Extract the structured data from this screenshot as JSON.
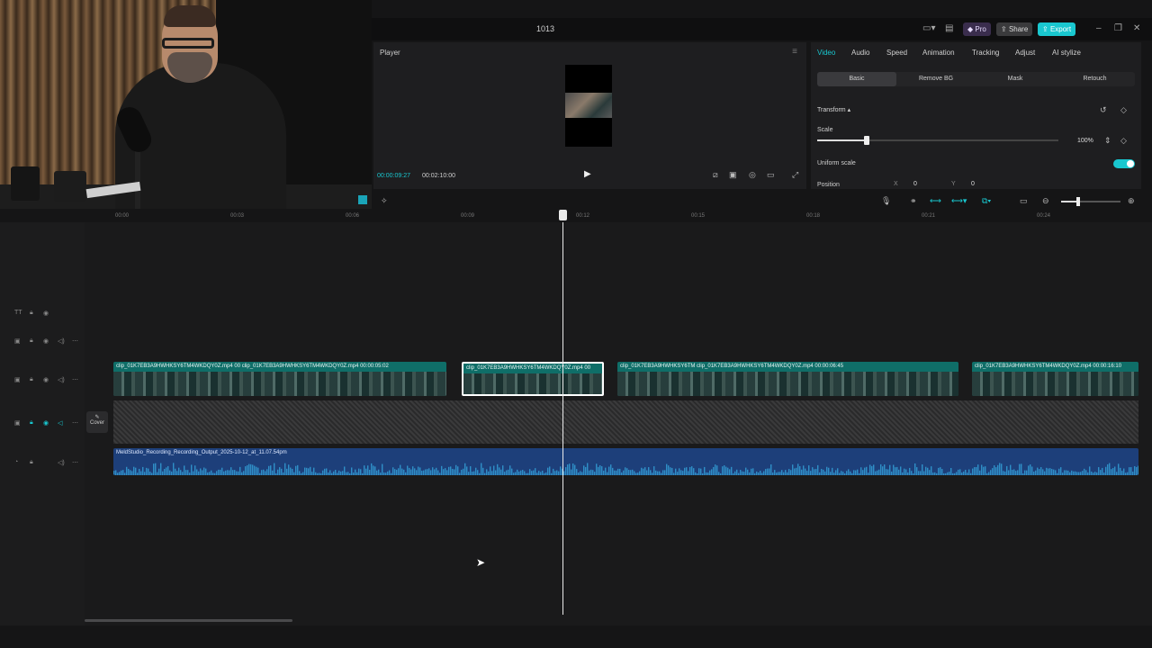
{
  "window": {
    "title": "1013"
  },
  "topbar": {
    "pro_label": "Pro",
    "share_label": "Share",
    "export_label": "Export"
  },
  "player": {
    "title": "Player",
    "current_time": "00:00:09:27",
    "total_time": "00:02:10:00"
  },
  "inspector": {
    "tabs": [
      "Video",
      "Audio",
      "Speed",
      "Animation",
      "Tracking",
      "Adjust",
      "AI stylize"
    ],
    "active_tab": "Video",
    "subtabs": [
      "Basic",
      "Remove BG",
      "Mask",
      "Retouch"
    ],
    "active_subtab": "Basic",
    "transform_label": "Transform",
    "scale_label": "Scale",
    "scale_value": "100%",
    "uniform_scale_label": "Uniform scale",
    "uniform_scale_on": true,
    "position_label": "Position",
    "x_label": "X",
    "x_value": "0",
    "y_label": "Y",
    "y_value": "0"
  },
  "ruler": {
    "ticks": [
      "00:00",
      "00:03",
      "00:06",
      "00:09",
      "00:12",
      "00:15",
      "00:18",
      "00:21",
      "00:24"
    ]
  },
  "timeline": {
    "cover_label": "Cover",
    "clips": [
      {
        "label": "clip_01K7EB3A9HWHKSY6TM4WKDQY0Z.mp4   00   clip_01K7EB3A9HWHKSY6TM4WKDQY0Z.mp4   00:00:05:02",
        "selected": false
      },
      {
        "label": "clip_01K7EB3A9HWHKSY6TM4WKDQY0Z.mp4   00",
        "selected": true
      },
      {
        "label": "clip_01K7EB3A9HWHKSY6TM   clip_01K7EB3A9HWHKSY6TM4WKDQY0Z.mp4   00:00:06:45",
        "selected": false
      },
      {
        "label": "clip_01K7EB3A9HWHKSY6TM4WKDQY0Z.mp4   00:00:16:10",
        "selected": false
      }
    ],
    "audio_label": "MeldStudio_Recording_Recording_Output_2025-10-12_at_11.07.54pm"
  },
  "colors": {
    "accent": "#19c7cf",
    "clip": "#0f6e68",
    "audio": "#1d3f7a"
  },
  "icons": [
    "layout-icon",
    "share-icon",
    "window-min-icon",
    "window-restore-icon",
    "close-icon",
    "play-icon",
    "fullscreen-icon",
    "microphone-icon",
    "zoom-out-icon",
    "zoom-in-icon",
    "lock-icon",
    "eye-icon",
    "speaker-icon"
  ]
}
